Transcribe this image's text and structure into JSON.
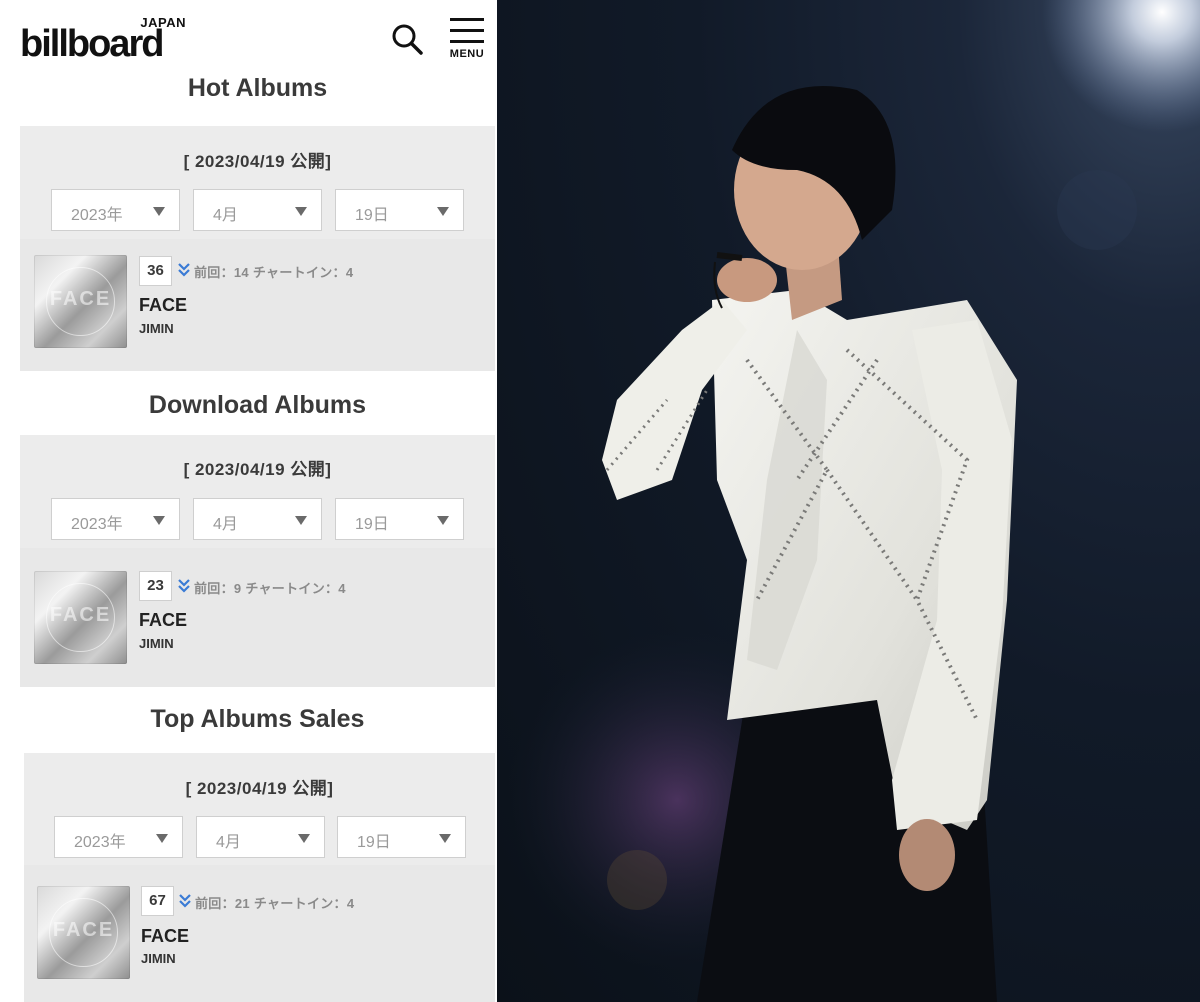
{
  "header": {
    "logo_small": "JAPAN",
    "logo_main": "billboard",
    "menu_label": "MENU"
  },
  "sections": [
    {
      "title": "Hot Albums",
      "date_label": "[ 2023/04/19 公開]",
      "selects": {
        "year": "2023年",
        "month": "4月",
        "day": "19日"
      },
      "entry": {
        "rank": "36",
        "meta": "前回：14 チャートイン：4",
        "album": "FACE",
        "artist": "JIMIN",
        "cover_text": "FACE"
      }
    },
    {
      "title": "Download Albums",
      "date_label": "[ 2023/04/19 公開]",
      "selects": {
        "year": "2023年",
        "month": "4月",
        "day": "19日"
      },
      "entry": {
        "rank": "23",
        "meta": "前回：9 チャートイン：4",
        "album": "FACE",
        "artist": "JIMIN",
        "cover_text": "FACE"
      }
    },
    {
      "title": "Top Albums Sales",
      "date_label": "[ 2023/04/19 公開]",
      "selects": {
        "year": "2023年",
        "month": "4月",
        "day": "19日"
      },
      "entry": {
        "rank": "67",
        "meta": "前回：21 チャートイン：4",
        "album": "FACE",
        "artist": "JIMIN",
        "cover_text": "FACE"
      }
    }
  ],
  "colors": {
    "panel_bg": "#ececec",
    "entry_bg": "#e8e8e8",
    "down_arrow": "#3a7bd5",
    "photo_bg": "#111a28"
  },
  "icons": [
    "search-icon",
    "menu-icon",
    "down-arrow-icon",
    "dropdown-arrow-icon"
  ]
}
